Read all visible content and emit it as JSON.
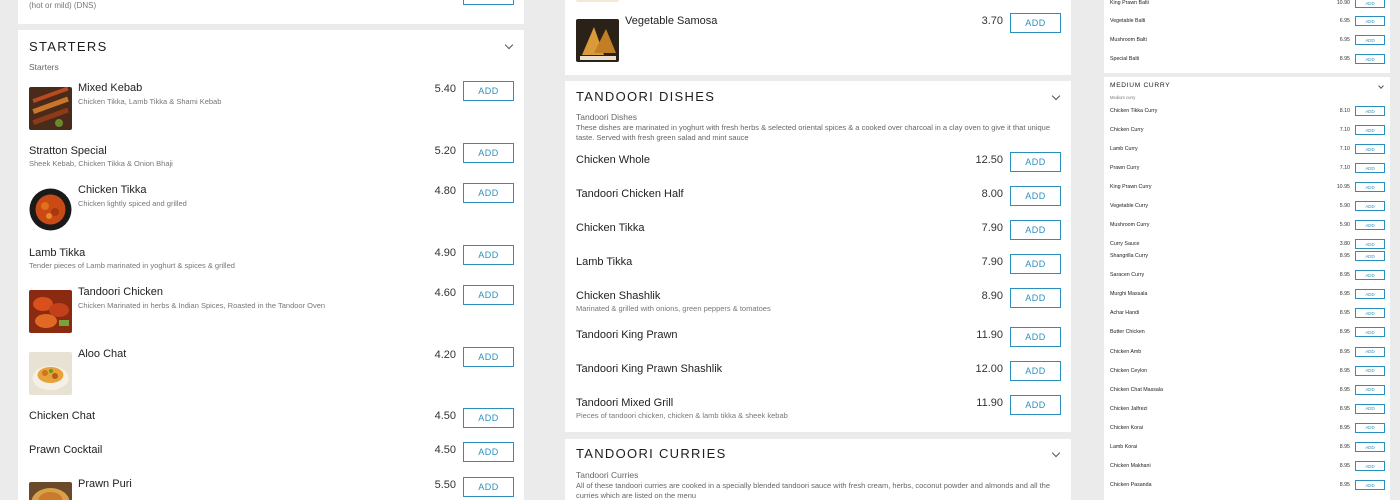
{
  "col1": {
    "top_note": "(hot or mild) (DNS)",
    "title": "STARTERS",
    "subtitle": "Starters",
    "items": [
      {
        "name": "Mixed Kebab",
        "desc": "Chicken Tikka, Lamb Tikka & Shami Kebab",
        "price": "5.40",
        "add": "ADD"
      },
      {
        "name": "Stratton Special",
        "desc": "Sheek Kebab, Chicken Tikka & Onion Bhaji",
        "price": "5.20",
        "add": "ADD"
      },
      {
        "name": "Chicken Tikka",
        "desc": "Chicken lightly spiced and grilled",
        "price": "4.80",
        "add": "ADD"
      },
      {
        "name": "Lamb Tikka",
        "desc": "Tender pieces of Lamb marinated in yoghurt & spices & grilled",
        "price": "4.90",
        "add": "ADD"
      },
      {
        "name": "Tandoori Chicken",
        "desc": "Chicken Marinated in herbs & Indian Spices, Roasted in the Tandoor Oven",
        "price": "4.60",
        "add": "ADD"
      },
      {
        "name": "Aloo Chat",
        "desc": "",
        "price": "4.20",
        "add": "ADD"
      },
      {
        "name": "Chicken Chat",
        "desc": "",
        "price": "4.50",
        "add": "ADD"
      },
      {
        "name": "Prawn Cocktail",
        "desc": "",
        "price": "4.50",
        "add": "ADD"
      },
      {
        "name": "Prawn Puri",
        "desc": "",
        "price": "5.50",
        "add": "ADD"
      }
    ]
  },
  "col2": {
    "top_item": {
      "name": "Vegetable Samosa",
      "price": "3.70",
      "add": "ADD"
    },
    "tandoori": {
      "title": "TANDOORI DISHES",
      "sub_title": "Tandoori Dishes",
      "sub_desc": "These dishes are marinated in yoghurt with fresh herbs & selected oriental spices & a cooked over charcoal in a clay oven to give it that unique taste. Served with fresh green salad and mint sauce",
      "items": [
        {
          "name": "Chicken Whole",
          "desc": "",
          "price": "12.50",
          "add": "ADD"
        },
        {
          "name": "Tandoori Chicken Half",
          "desc": "",
          "price": "8.00",
          "add": "ADD"
        },
        {
          "name": "Chicken Tikka",
          "desc": "",
          "price": "7.90",
          "add": "ADD"
        },
        {
          "name": "Lamb Tikka",
          "desc": "",
          "price": "7.90",
          "add": "ADD"
        },
        {
          "name": "Chicken Shashlik",
          "desc": "Marinated & grilled with onions, green peppers & tomatoes",
          "price": "8.90",
          "add": "ADD"
        },
        {
          "name": "Tandoori King Prawn",
          "desc": "",
          "price": "11.90",
          "add": "ADD"
        },
        {
          "name": "Tandoori King Prawn Shashlik",
          "desc": "",
          "price": "12.00",
          "add": "ADD"
        },
        {
          "name": "Tandoori Mixed Grill",
          "desc": "Pieces of tandoori chicken, chicken & lamb tikka & sheek kebab",
          "price": "11.90",
          "add": "ADD"
        }
      ]
    },
    "curries": {
      "title": "TANDOORI CURRIES",
      "sub_title": "Tandoori Curries",
      "sub_desc": "All of these tandoori curries are cooked in a specially blended tandoori sauce with fresh cream, herbs, coconut powder and almonds and all the curries which are listed on the menu"
    }
  },
  "col3": {
    "balti_items": [
      {
        "name": "King Prawn Balti",
        "price": "10.90",
        "add": "ADD"
      },
      {
        "name": "Vegetable Balti",
        "price": "6.95",
        "add": "ADD"
      },
      {
        "name": "Mushroom Balti",
        "price": "6.95",
        "add": "ADD"
      },
      {
        "name": "Special Balti",
        "price": "8.95",
        "add": "ADD"
      }
    ],
    "medium": {
      "title": "MEDIUM CURRY",
      "sub": "Medium curry",
      "items": [
        {
          "name": "Chicken Tikka Curry",
          "price": "8.10",
          "add": "ADD"
        },
        {
          "name": "Chicken Curry",
          "price": "7.10",
          "add": "ADD"
        },
        {
          "name": "Lamb Curry",
          "price": "7.10",
          "add": "ADD"
        },
        {
          "name": "Prawn Curry",
          "price": "7.10",
          "add": "ADD"
        },
        {
          "name": "King Prawn Curry",
          "price": "10.95",
          "add": "ADD"
        },
        {
          "name": "Vegetable Curry",
          "price": "5.90",
          "add": "ADD"
        },
        {
          "name": "Mushroom Curry",
          "price": "5.90",
          "add": "ADD"
        },
        {
          "name": "Curry Sauce",
          "price": "3.80",
          "add": "ADD"
        }
      ]
    },
    "special_items": [
      {
        "name": "Shangrilla Curry",
        "price": "8.95",
        "add": "ADD"
      },
      {
        "name": "Saracen Curry",
        "price": "8.95",
        "add": "ADD"
      },
      {
        "name": "Murghi Massala",
        "price": "8.95",
        "add": "ADD"
      },
      {
        "name": "Achar Handi",
        "price": "8.95",
        "add": "ADD"
      },
      {
        "name": "Butter Chicken",
        "price": "8.95",
        "add": "ADD"
      },
      {
        "name": "Chicken Amb",
        "price": "8.95",
        "add": "ADD"
      },
      {
        "name": "Chicken Ceylon",
        "price": "8.95",
        "add": "ADD"
      },
      {
        "name": "Chicken Chat Massala",
        "price": "8.95",
        "add": "ADD"
      },
      {
        "name": "Chicken Jalfrezi",
        "price": "8.95",
        "add": "ADD"
      },
      {
        "name": "Chicken Korai",
        "price": "8.95",
        "add": "ADD"
      },
      {
        "name": "Lamb Korai",
        "price": "8.95",
        "add": "ADD"
      },
      {
        "name": "Chicken Makhani",
        "price": "8.95",
        "add": "ADD"
      },
      {
        "name": "Chicken Pasanda",
        "price": "8.95",
        "add": "ADD"
      }
    ]
  },
  "colors": {
    "accent": "#2a8fbd",
    "page_bg": "#ebebeb"
  }
}
